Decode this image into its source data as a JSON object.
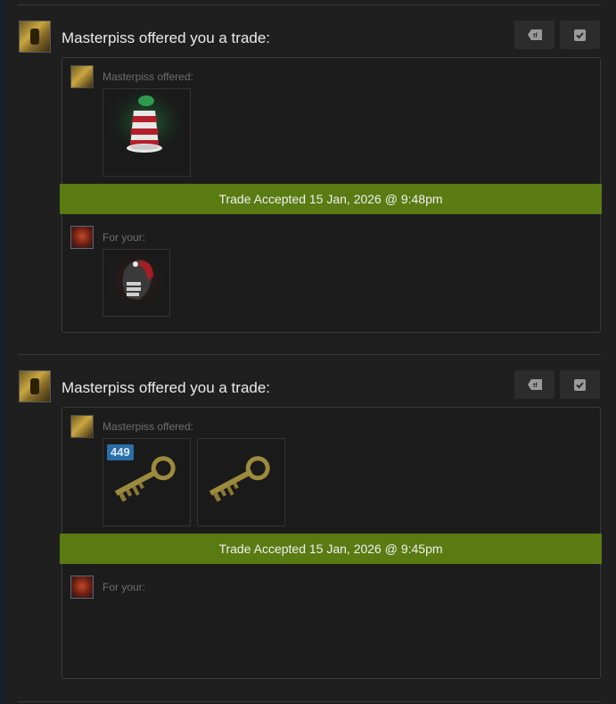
{
  "offers": [
    {
      "title": "Masterpiss offered you a trade:",
      "their_label": "Masterpiss offered:",
      "your_label": "For your:",
      "status": "Trade Accepted 15 Jan, 2026 @ 9:48pm",
      "their_items": [
        {
          "name": "striped-hat-item"
        }
      ],
      "your_items": [
        {
          "name": "helmet-item"
        }
      ]
    },
    {
      "title": "Masterpiss offered you a trade:",
      "their_label": "Masterpiss offered:",
      "your_label": "For your:",
      "status": "Trade Accepted 15 Jan, 2026 @ 9:45pm",
      "their_items": [
        {
          "name": "key-item",
          "badge": "449"
        },
        {
          "name": "key-item"
        }
      ],
      "your_items": []
    }
  ],
  "buttons": {
    "tf_icon": "tf-icon",
    "check_icon": "checkmark-icon"
  },
  "colors": {
    "accepted_bar": "#5a7b12",
    "badge": "#2a6ea8"
  }
}
